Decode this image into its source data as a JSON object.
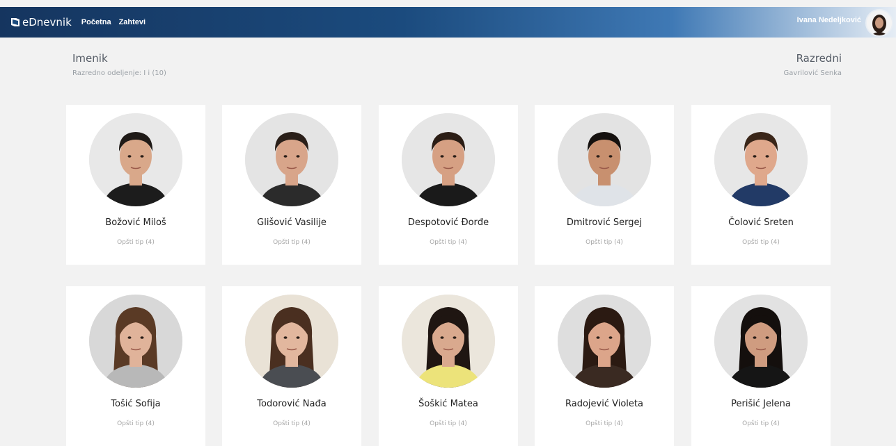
{
  "app": {
    "brand": "eDnevnik"
  },
  "nav": {
    "items": [
      "Početna",
      "Zahtevi"
    ]
  },
  "user": {
    "name": "Ivana Nedeljković"
  },
  "header": {
    "title": "Imenik",
    "subtitle": "Razredno odeljenje: I i (10)",
    "right_title": "Razredni",
    "right_subtitle": "Gavrilović Senka"
  },
  "students": [
    {
      "name": "Božović Miloš",
      "program": "Opšti tip (4)"
    },
    {
      "name": "Glišović Vasilije",
      "program": "Opšti tip (4)"
    },
    {
      "name": "Despotović Đorđe",
      "program": "Opšti tip (4)"
    },
    {
      "name": "Dmitrović Sergej",
      "program": "Opšti tip (4)"
    },
    {
      "name": "Čolović Sreten",
      "program": "Opšti tip (4)"
    },
    {
      "name": "Tošić Sofija",
      "program": "Opšti tip (4)"
    },
    {
      "name": "Todorović Nađa",
      "program": "Opšti tip (4)"
    },
    {
      "name": "Šoškić Matea",
      "program": "Opšti tip (4)"
    },
    {
      "name": "Radojević Violeta",
      "program": "Opšti tip (4)"
    },
    {
      "name": "Perišić Jelena",
      "program": "Opšti tip (4)"
    }
  ],
  "colors": {
    "navbar_dark": "#15355f",
    "navbar_light": "#3f79b5",
    "background": "#f2f2f2"
  }
}
